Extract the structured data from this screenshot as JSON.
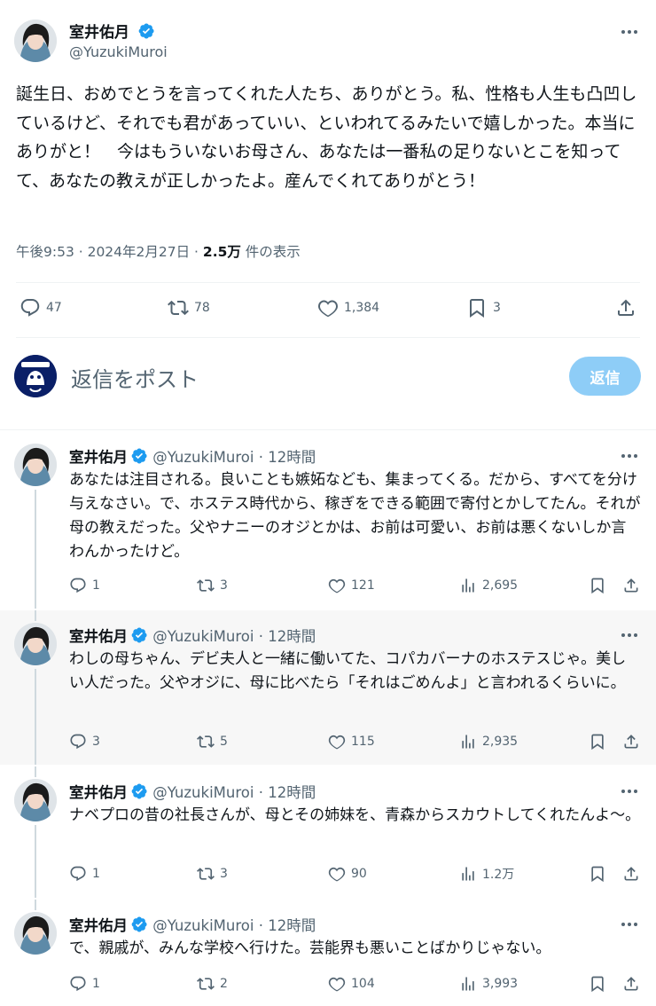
{
  "main": {
    "author_name": "室井佑月",
    "handle": "@YuzukiMuroi",
    "text": "誕生日、おめでとうを言ってくれた人たち、ありがとう。私、性格も人生も凸凹しているけど、それでも君があっていい、といわれてるみたいで嬉しかった。本当にありがと！　今はもういないお母さん、あなたは一番私の足りないとこを知ってて、あなたの教えが正しかったよ。産んでくれてありがとう！",
    "time": "午後9:53 · 2024年2月27日 · ",
    "views_count": "2.5万",
    "views_label": " 件の表示",
    "replies": "47",
    "reposts": "78",
    "likes": "1,384",
    "bookmarks": "3"
  },
  "composer": {
    "placeholder": "返信をポスト",
    "button_label": "返信"
  },
  "replies": [
    {
      "author_name": "室井佑月",
      "handle": "@YuzukiMuroi",
      "time": "· 12時間",
      "text": "あなたは注目される。良いことも嫉妬なども、集まってくる。だから、すべてを分け与えなさい。で、ホステス時代から、稼ぎをできる範囲で寄付とかしてたん。それが母の教えだった。父やナニーのオジとかは、お前は可愛い、お前は悪くないしか言わんかったけど。",
      "replies": "1",
      "reposts": "3",
      "likes": "121",
      "views": "2,695"
    },
    {
      "author_name": "室井佑月",
      "handle": "@YuzukiMuroi",
      "time": "· 12時間",
      "text": "わしの母ちゃん、デビ夫人と一緒に働いてた、コパカバーナのホステスじゃ。美しい人だった。父やオジに、母に比べたら「それはごめんよ」と言われるくらいに。",
      "replies": "3",
      "reposts": "5",
      "likes": "115",
      "views": "2,935"
    },
    {
      "author_name": "室井佑月",
      "handle": "@YuzukiMuroi",
      "time": "· 12時間",
      "text": "ナベプロの昔の社長さんが、母とその姉妹を、青森からスカウトしてくれたんよ〜。",
      "replies": "1",
      "reposts": "3",
      "likes": "90",
      "views": "1.2万"
    },
    {
      "author_name": "室井佑月",
      "handle": "@YuzukiMuroi",
      "time": "· 12時間",
      "text": "で、親戚が、みんな学校へ行けた。芸能界も悪いことばかりじゃない。",
      "replies": "1",
      "reposts": "2",
      "likes": "104",
      "views": "3,993"
    }
  ],
  "colors": {
    "accent": "#1d9bf0",
    "reply_button": "#8ecdf7",
    "muted": "#536471",
    "highlight_bg": "#f7f7f7"
  },
  "icons": [
    "more-icon",
    "verified-icon",
    "reply-icon",
    "repost-icon",
    "like-icon",
    "bookmark-icon",
    "share-icon",
    "views-icon"
  ]
}
